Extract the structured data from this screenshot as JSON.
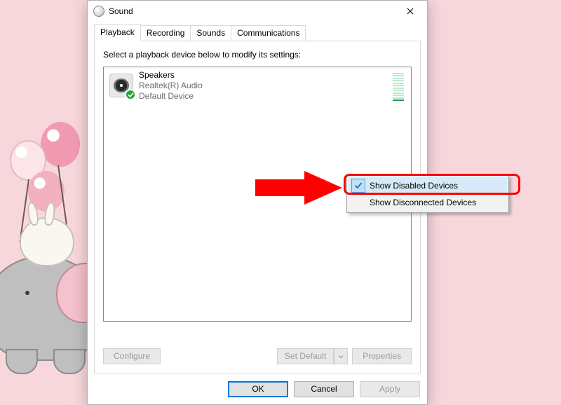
{
  "window": {
    "title": "Sound"
  },
  "tabs": {
    "items": [
      {
        "label": "Playback"
      },
      {
        "label": "Recording"
      },
      {
        "label": "Sounds"
      },
      {
        "label": "Communications"
      }
    ],
    "active_index": 0
  },
  "panel": {
    "instruction": "Select a playback device below to modify its settings:"
  },
  "devices": [
    {
      "name": "Speakers",
      "driver": "Realtek(R) Audio",
      "status": "Default Device",
      "is_default": true
    }
  ],
  "panel_buttons": {
    "configure": "Configure",
    "set_default": "Set Default",
    "properties": "Properties"
  },
  "dialog_buttons": {
    "ok": "OK",
    "cancel": "Cancel",
    "apply": "Apply"
  },
  "context_menu": {
    "items": [
      {
        "label": "Show Disabled Devices",
        "checked": true,
        "hover": true
      },
      {
        "label": "Show Disconnected Devices",
        "checked": false,
        "hover": false
      }
    ]
  }
}
